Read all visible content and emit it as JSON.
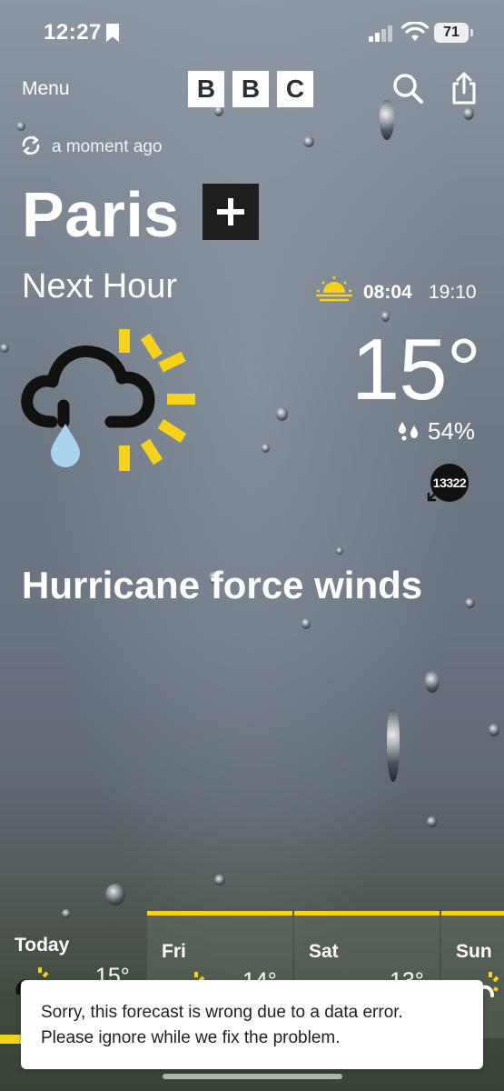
{
  "status_bar": {
    "time": "12:27",
    "battery": "71"
  },
  "header": {
    "menu_label": "Menu",
    "logo_letters": [
      "B",
      "B",
      "C"
    ]
  },
  "location": {
    "updated": "a moment ago",
    "city": "Paris"
  },
  "summary": {
    "period": "Next Hour",
    "sunrise": "08:04",
    "sunset": "19:10",
    "temperature": "15°",
    "humidity": "54%",
    "wind_speed": "13322",
    "headline": "Hurricane force winds",
    "icon": "cloud-rain-sun-icon"
  },
  "forecast": [
    {
      "label": "Today",
      "temp": "15°",
      "icon": "sun-cloud-icon"
    },
    {
      "label": "Fri",
      "temp": "14°",
      "icon": "sun-cloud-icon"
    },
    {
      "label": "Sat",
      "temp": "13°",
      "icon": "sun-cloud-icon"
    },
    {
      "label": "Sun",
      "temp": "",
      "icon": "sun-cloud-icon"
    }
  ],
  "toast": {
    "line1": "Sorry, this forecast is wrong due to a data error.",
    "line2": "Please ignore while we fix the problem."
  },
  "colors": {
    "accent_yellow": "#f6d21b",
    "icon_black": "#111111",
    "rain_blue": "#a9d3ef"
  }
}
